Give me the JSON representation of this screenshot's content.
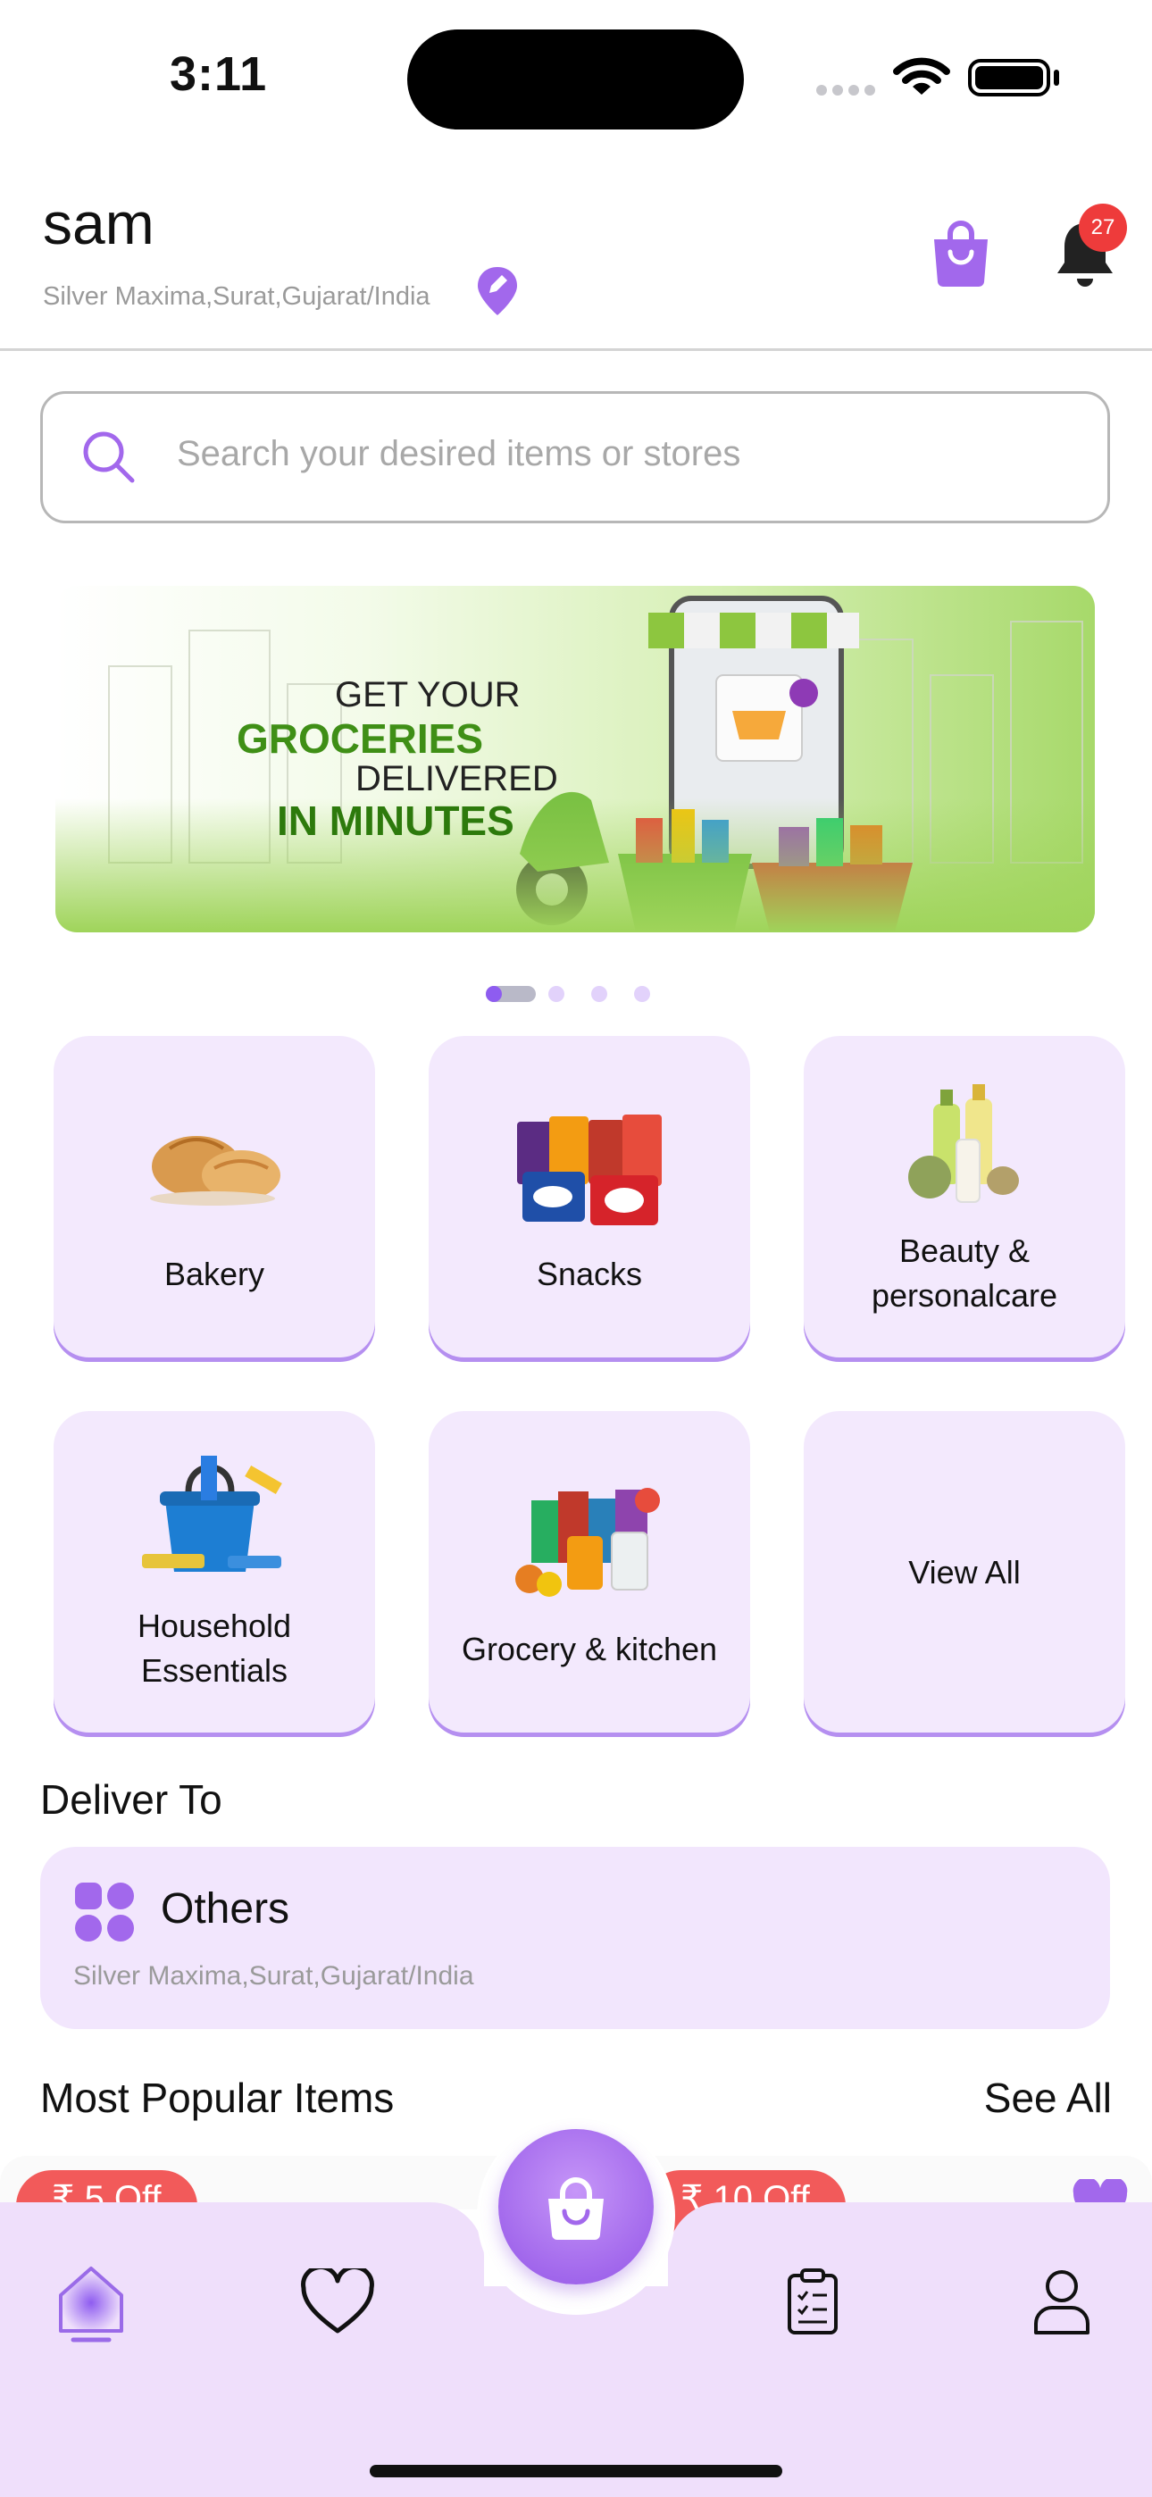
{
  "status_bar": {
    "time": "3:11"
  },
  "header": {
    "username": "sam",
    "address": "Silver Maxima,Surat,Gujarat/India",
    "notification_count": "27"
  },
  "search": {
    "placeholder": "Search your desired items or stores"
  },
  "banner": {
    "line1": "GET YOUR",
    "line2": "GROCERIES",
    "line3": "DELIVERED",
    "line4": "IN MINUTES",
    "page_count": 4,
    "active_page": 1
  },
  "categories": [
    {
      "label": "Bakery"
    },
    {
      "label": "Snacks"
    },
    {
      "label": "Beauty &",
      "label2": "personalcare"
    },
    {
      "label": "Household",
      "label2": "Essentials"
    },
    {
      "label": "Grocery & kitchen"
    },
    {
      "label": "View All"
    }
  ],
  "deliver": {
    "title": "Deliver To",
    "type": "Others",
    "address": "Silver Maxima,Surat,Gujarat/India"
  },
  "popular": {
    "title": "Most Popular Items",
    "see_all": "See All",
    "offers": [
      "₹ 5 Off",
      "₹ 10 Off"
    ]
  },
  "nav": {
    "items": [
      "home-icon",
      "heart-icon",
      "cart-icon",
      "orders-icon",
      "profile-icon"
    ],
    "active": "home-icon"
  },
  "colors": {
    "accent": "#a268ec",
    "card_bg": "#f3e9fd",
    "badge": "#ee3b3b",
    "offer": "#f25a5a"
  }
}
